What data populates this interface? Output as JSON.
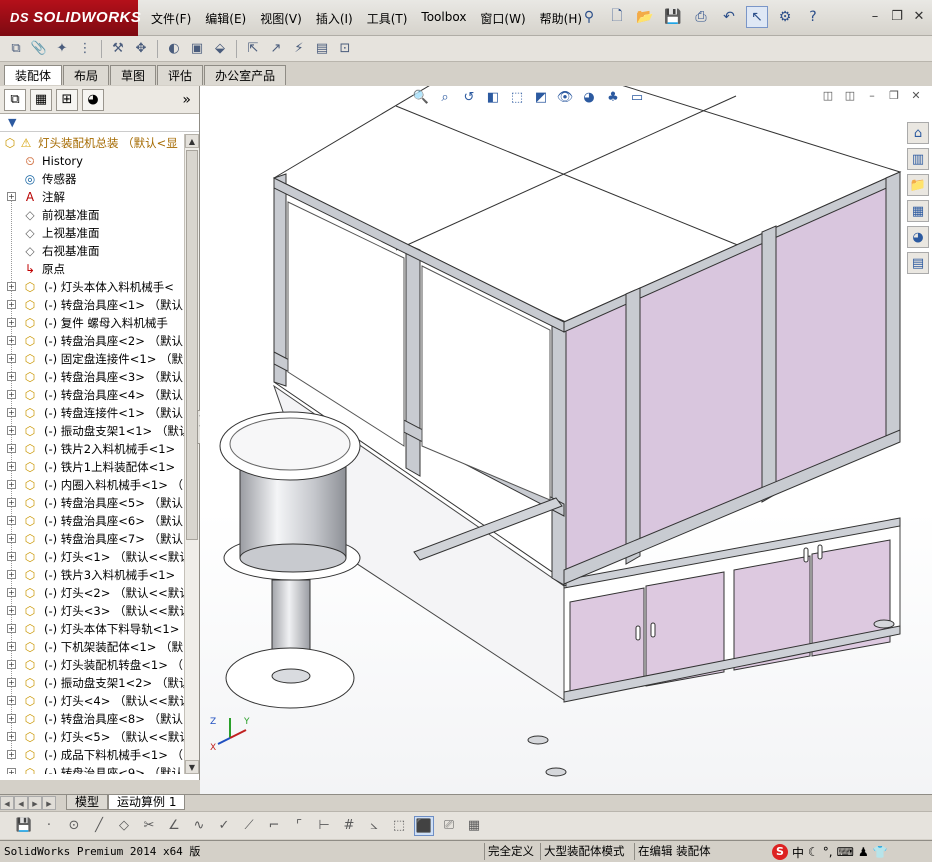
{
  "app": {
    "brand": "SOLIDWORKS",
    "brand_prefix": "DS"
  },
  "menus": [
    "文件(F)",
    "编辑(E)",
    "视图(V)",
    "插入(I)",
    "工具(T)",
    "Toolbox",
    "窗口(W)",
    "帮助(H)"
  ],
  "command_tabs": [
    "装配体",
    "布局",
    "草图",
    "评估",
    "办公室产品"
  ],
  "feature_tree": {
    "root": "灯头装配机总装 （默认<显",
    "items": [
      {
        "type": "history",
        "label": "History"
      },
      {
        "type": "sensor",
        "label": "传感器"
      },
      {
        "type": "annotation",
        "label": "注解"
      },
      {
        "type": "plane",
        "label": "前视基准面"
      },
      {
        "type": "plane",
        "label": "上视基准面"
      },
      {
        "type": "plane",
        "label": "右视基准面"
      },
      {
        "type": "origin",
        "label": "原点"
      },
      {
        "type": "part",
        "label": "(-) 灯头本体入料机械手<"
      },
      {
        "type": "part",
        "label": "(-) 转盘治具座<1> （默认"
      },
      {
        "type": "part",
        "label": "(-) 复件 螺母入料机械手"
      },
      {
        "type": "part",
        "label": "(-) 转盘治具座<2> （默认"
      },
      {
        "type": "part",
        "label": "(-) 固定盘连接件<1> （默"
      },
      {
        "type": "part",
        "label": "(-) 转盘治具座<3> （默认"
      },
      {
        "type": "part",
        "label": "(-) 转盘治具座<4> （默认"
      },
      {
        "type": "part",
        "label": "(-) 转盘连接件<1> （默认"
      },
      {
        "type": "part",
        "label": "(-) 振动盘支架1<1> （默认"
      },
      {
        "type": "part",
        "label": "(-) 铁片2入料机械手<1>"
      },
      {
        "type": "part",
        "label": "(-) 铁片1上料装配体<1>"
      },
      {
        "type": "part",
        "label": "(-) 内圈入料机械手<1> （"
      },
      {
        "type": "part",
        "label": "(-) 转盘治具座<5> （默认"
      },
      {
        "type": "part",
        "label": "(-) 转盘治具座<6> （默认"
      },
      {
        "type": "part",
        "label": "(-) 转盘治具座<7> （默认"
      },
      {
        "type": "part",
        "label": "(-) 灯头<1> （默认<<默认"
      },
      {
        "type": "part",
        "label": "(-) 铁片3入料机械手<1>"
      },
      {
        "type": "part",
        "label": "(-) 灯头<2> （默认<<默认"
      },
      {
        "type": "part",
        "label": "(-) 灯头<3> （默认<<默认"
      },
      {
        "type": "part",
        "label": "(-) 灯头本体下料导轨<1>"
      },
      {
        "type": "part",
        "label": "(-) 下机架装配体<1> （默"
      },
      {
        "type": "part",
        "label": "(-) 灯头装配机转盘<1> （"
      },
      {
        "type": "part",
        "label": "(-) 振动盘支架1<2> （默认"
      },
      {
        "type": "part",
        "label": "(-) 灯头<4> （默认<<默认"
      },
      {
        "type": "part",
        "label": "(-) 转盘治具座<8> （默认"
      },
      {
        "type": "part",
        "label": "(-) 灯头<5> （默认<<默认"
      },
      {
        "type": "part",
        "label": "(-) 成品下料机械手<1> （"
      },
      {
        "type": "part",
        "label": "(-) 转盘治具座<9> （默认"
      }
    ]
  },
  "model_tabs": [
    "模型",
    "运动算例 1"
  ],
  "status": {
    "version": "SolidWorks Premium 2014 x64 版",
    "definition": "完全定义",
    "mode": "大型装配体模式",
    "editing": "在编辑 装配体"
  },
  "triad": {
    "z": "Z",
    "x": "X",
    "y": "Y"
  },
  "tray": {
    "ime": "中"
  },
  "colors": {
    "panel_tint": "#dcc9e0",
    "frame": "#cfd2d8",
    "brand_red": "#a0121b"
  }
}
